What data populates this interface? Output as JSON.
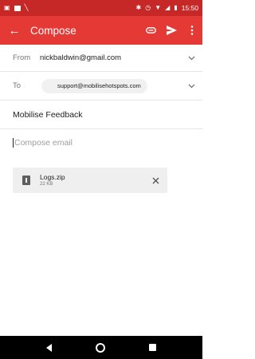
{
  "status_bar": {
    "time": "15:50",
    "left_icons": [
      "notification-box-icon",
      "image-icon",
      "missed-call-icon"
    ],
    "right_icons": [
      "bluetooth-icon",
      "alarm-icon",
      "wifi-icon",
      "signal-icon",
      "battery-icon"
    ]
  },
  "app_bar": {
    "title": "Compose",
    "back_icon": "arrow-left-icon",
    "actions": [
      "attach-icon",
      "send-icon",
      "more-vert-icon"
    ],
    "color": "#e53935",
    "status_color": "#c62828"
  },
  "from": {
    "label": "From",
    "value": "nickbaldwin@gmail.com"
  },
  "to": {
    "label": "To",
    "value": "support@mobilisehotspots.com"
  },
  "subject": {
    "value": "Mobilise Feedback"
  },
  "compose": {
    "placeholder": "Compose email"
  },
  "attachment": {
    "name": "Logs.zip",
    "size": "22 KB"
  }
}
